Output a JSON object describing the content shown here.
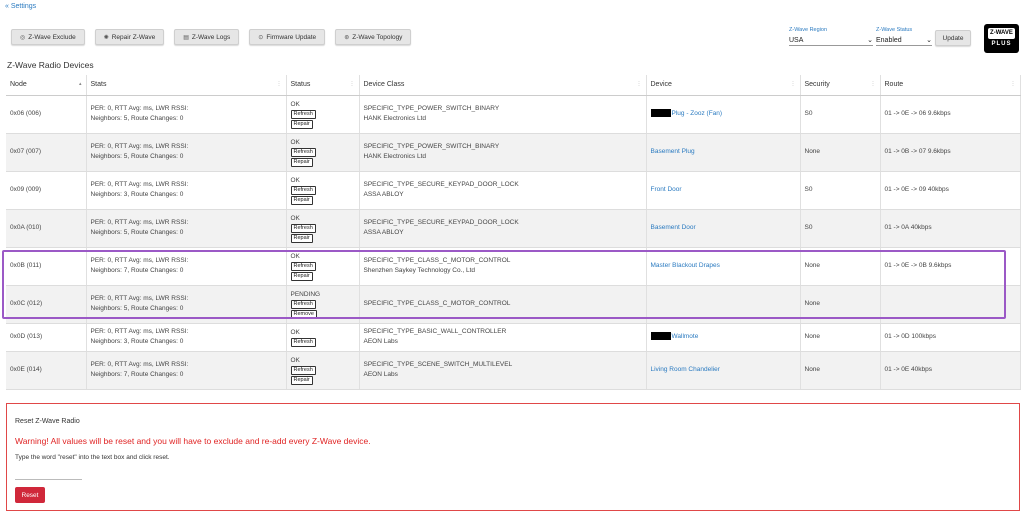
{
  "breadcrumb": "« Settings",
  "toolbar": [
    {
      "label": "Z-Wave Exclude",
      "icon": "◎"
    },
    {
      "label": "Repair Z-Wave",
      "icon": "✺"
    },
    {
      "label": "Z-Wave Logs",
      "icon": "▤"
    },
    {
      "label": "Firmware Update",
      "icon": "⊙"
    },
    {
      "label": "Z-Wave Topology",
      "icon": "⊛"
    }
  ],
  "region": {
    "label": "Z-Wave Region",
    "value": "USA"
  },
  "status": {
    "label": "Z-Wave Status",
    "value": "Enabled"
  },
  "update_label": "Update",
  "logo": {
    "top": "Z-WAVE",
    "bottom": "PLUS"
  },
  "section_title": "Z-Wave Radio Devices",
  "headers": {
    "node": "Node",
    "stats": "Stats",
    "status": "Status",
    "device_class": "Device Class",
    "device": "Device",
    "security": "Security",
    "route": "Route"
  },
  "rows": [
    {
      "node": "0x06 (006)",
      "stats1": "PER: 0, RTT Avg: ms, LWR RSSI:",
      "stats2": "Neighbors: 5, Route Changes: 0",
      "status": "OK",
      "btn1": "Refresh",
      "btn2": "Repair",
      "class1": "SPECIFIC_TYPE_POWER_SWITCH_BINARY",
      "class2": "HANK Electronics Ltd",
      "device": "Plug - Zooz (Fan)",
      "redacted": true,
      "security": "S0",
      "route": "01 -> 0E -> 06 9.6kbps"
    },
    {
      "node": "0x07 (007)",
      "stats1": "PER: 0, RTT Avg: ms, LWR RSSI:",
      "stats2": "Neighbors: 5, Route Changes: 0",
      "status": "OK",
      "btn1": "Refresh",
      "btn2": "Repair",
      "class1": "SPECIFIC_TYPE_POWER_SWITCH_BINARY",
      "class2": "HANK Electronics Ltd",
      "device": "Basement Plug",
      "redacted": false,
      "security": "None",
      "route": "01 -> 0B -> 07 9.6kbps"
    },
    {
      "node": "0x09 (009)",
      "stats1": "PER: 0, RTT Avg: ms, LWR RSSI:",
      "stats2": "Neighbors: 3, Route Changes: 0",
      "status": "OK",
      "btn1": "Refresh",
      "btn2": "Repair",
      "class1": "SPECIFIC_TYPE_SECURE_KEYPAD_DOOR_LOCK",
      "class2": "ASSA ABLOY",
      "device": "Front Door",
      "redacted": false,
      "security": "S0",
      "route": "01 -> 0E -> 09 40kbps"
    },
    {
      "node": "0x0A (010)",
      "stats1": "PER: 0, RTT Avg: ms, LWR RSSI:",
      "stats2": "Neighbors: 5, Route Changes: 0",
      "status": "OK",
      "btn1": "Refresh",
      "btn2": "Repair",
      "class1": "SPECIFIC_TYPE_SECURE_KEYPAD_DOOR_LOCK",
      "class2": "ASSA ABLOY",
      "device": "Basement Door",
      "redacted": false,
      "security": "S0",
      "route": "01 -> 0A 40kbps"
    },
    {
      "node": "0x0B (011)",
      "stats1": "PER: 0, RTT Avg: ms, LWR RSSI:",
      "stats2": "Neighbors: 7, Route Changes: 0",
      "status": "OK",
      "btn1": "Refresh",
      "btn2": "Repair",
      "class1": "SPECIFIC_TYPE_CLASS_C_MOTOR_CONTROL",
      "class2": "Shenzhen Saykey Technology Co., Ltd",
      "device": "Master Blackout Drapes",
      "redacted": false,
      "security": "None",
      "route": "01 -> 0E -> 0B 9.6kbps"
    },
    {
      "node": "0x0C (012)",
      "stats1": "PER: 0, RTT Avg: ms, LWR RSSI:",
      "stats2": "Neighbors: 5, Route Changes: 0",
      "status": "PENDING",
      "btn1": "Refresh",
      "btn2": "Remove",
      "class1": "SPECIFIC_TYPE_CLASS_C_MOTOR_CONTROL",
      "class2": "",
      "device": "",
      "redacted": false,
      "security": "None",
      "route": ""
    },
    {
      "node": "0x0D (013)",
      "stats1": "PER: 0, RTT Avg: ms, LWR RSSI:",
      "stats2": "Neighbors: 3, Route Changes: 0",
      "status": "OK",
      "btn1": "Refresh",
      "btn2": "",
      "class1": "SPECIFIC_TYPE_BASIC_WALL_CONTROLLER",
      "class2": "AEON Labs",
      "device": "Wallmote",
      "redacted": true,
      "security": "None",
      "route": "01 -> 0D 100kbps"
    },
    {
      "node": "0x0E (014)",
      "stats1": "PER: 0, RTT Avg: ms, LWR RSSI:",
      "stats2": "Neighbors: 7, Route Changes: 0",
      "status": "OK",
      "btn1": "Refresh",
      "btn2": "Repair",
      "class1": "SPECIFIC_TYPE_SCENE_SWITCH_MULTILEVEL",
      "class2": "AEON Labs",
      "device": "Living Room Chandelier",
      "redacted": false,
      "security": "None",
      "route": "01 -> 0E 40kbps"
    }
  ],
  "reset": {
    "title": "Reset Z-Wave Radio",
    "warning": "Warning! All values will be reset and you will have to exclude and re-add every Z-Wave device.",
    "instruction": "Type the word \"reset\" into the text box and click reset.",
    "button": "Reset"
  },
  "colors": {
    "link": "#2a7ac0",
    "danger": "#d0283a",
    "highlight": "#9b59c6"
  }
}
